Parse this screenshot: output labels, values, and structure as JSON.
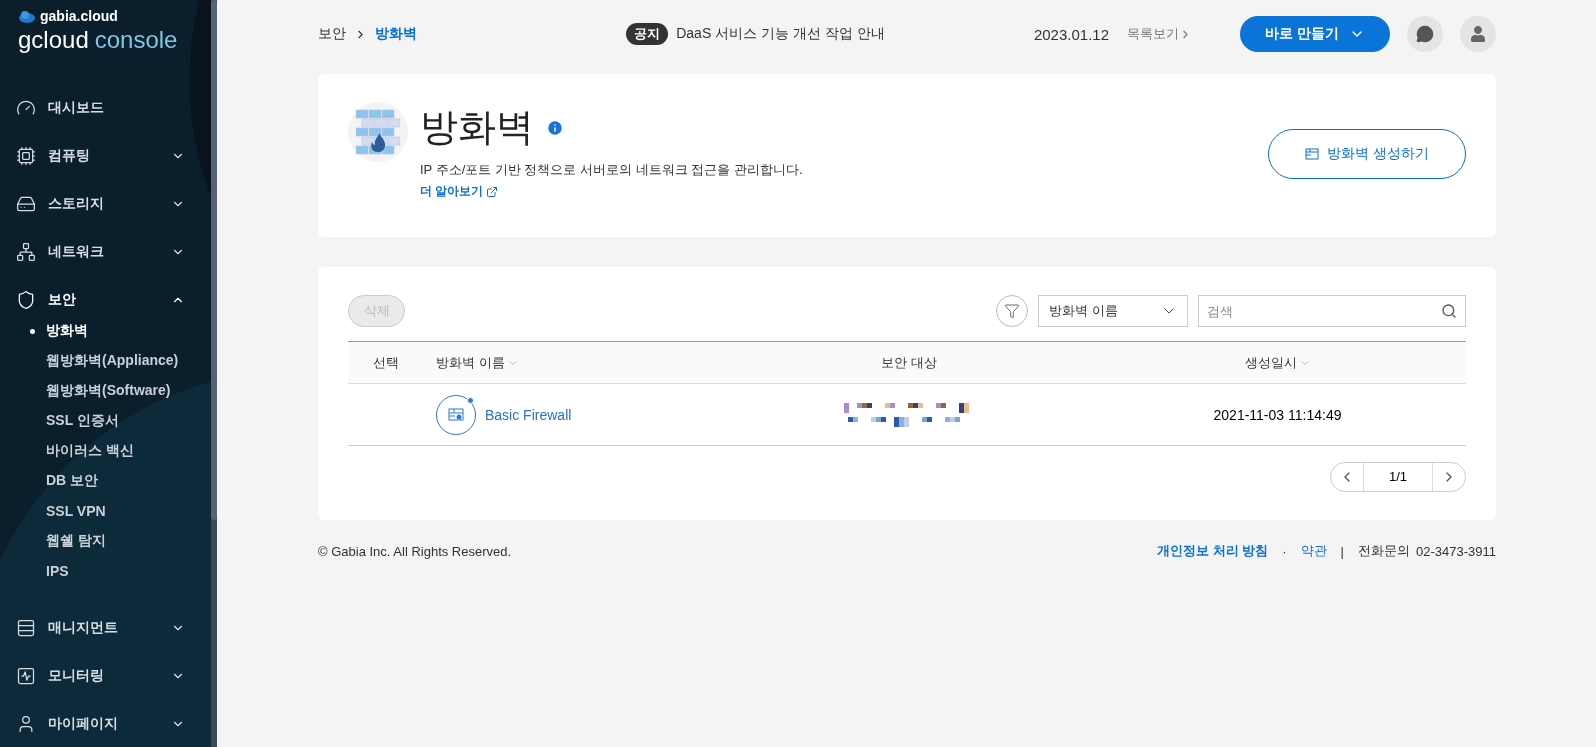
{
  "sidebar": {
    "logo": {
      "brand": "gabia.cloud",
      "product": "gcloud",
      "product_suffix": "console"
    },
    "items": [
      {
        "label": "대시보드"
      },
      {
        "label": "컴퓨팅",
        "expanded": false
      },
      {
        "label": "스토리지",
        "expanded": false
      },
      {
        "label": "네트워크",
        "expanded": false
      },
      {
        "label": "보안",
        "expanded": true,
        "children": [
          {
            "label": "방화벽",
            "selected": true
          },
          {
            "label": "웹방화벽(Appliance)",
            "selected": false
          },
          {
            "label": "웹방화벽(Software)",
            "selected": false
          },
          {
            "label": "SSL 인증서",
            "selected": false
          },
          {
            "label": "바이러스 백신",
            "selected": false
          },
          {
            "label": "DB 보안",
            "selected": false
          },
          {
            "label": "SSL VPN",
            "selected": false
          },
          {
            "label": "웹쉘 탐지",
            "selected": false
          },
          {
            "label": "IPS",
            "selected": false
          }
        ]
      },
      {
        "label": "매니지먼트",
        "expanded": false
      },
      {
        "label": "모니터링",
        "expanded": false
      },
      {
        "label": "마이페이지",
        "expanded": false
      }
    ]
  },
  "header": {
    "breadcrumb": [
      "보안",
      "방화벽"
    ],
    "notice": {
      "badge": "공지",
      "text": "DaaS 서비스 기능 개선 작업 안내",
      "date": "2023.01.12",
      "list_link": "목록보기"
    },
    "create_button": "바로 만들기"
  },
  "intro": {
    "title": "방화벽",
    "description": "IP 주소/포트 기반 정책으로 서버로의 네트워크 접근을 관리합니다.",
    "learn_more": "더 알아보기",
    "create_button": "방화벽 생성하기"
  },
  "toolbar": {
    "delete_button": {
      "label": "삭제",
      "disabled": true
    },
    "filter_select": {
      "value": "방화벽 이름"
    },
    "search": {
      "placeholder": "검색"
    }
  },
  "table": {
    "columns": [
      {
        "label": "선택",
        "sortable": false
      },
      {
        "label": "방화벽 이름",
        "sortable": true
      },
      {
        "label": "보안 대상",
        "sortable": false
      },
      {
        "label": "생성일시",
        "sortable": true
      }
    ],
    "rows": [
      {
        "name": "Basic Firewall",
        "created": "2021-11-03 11:14:49"
      }
    ]
  },
  "pagination": {
    "page": "1/1"
  },
  "footer": {
    "copyright": "© Gabia Inc. All Rights Reserved.",
    "privacy": "개인정보 처리 방침",
    "dot": "·",
    "terms": "약관",
    "bar": "|",
    "phone_label": "전화문의",
    "phone": "02-3473-3911"
  }
}
